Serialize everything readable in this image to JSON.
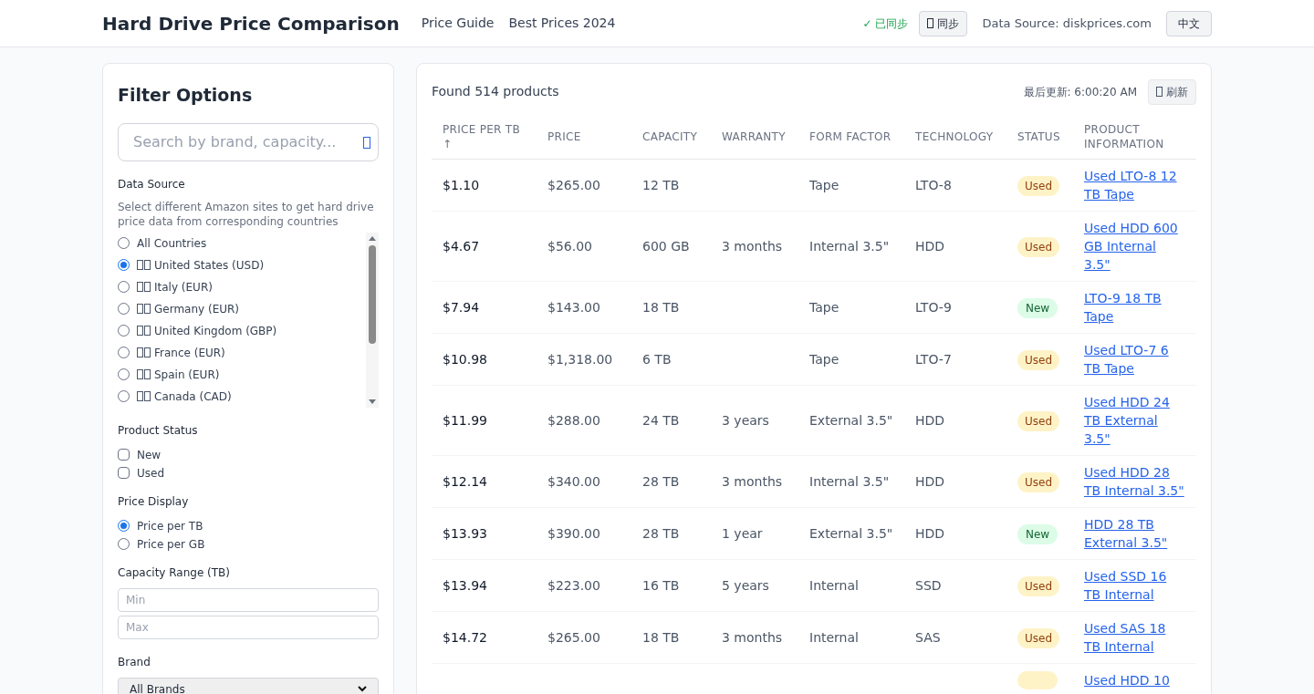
{
  "header": {
    "title": "Hard Drive Price Comparison",
    "nav": [
      "Price Guide",
      "Best Prices 2024"
    ],
    "sync_status": "✓ 已同步",
    "sync_button": "同步",
    "data_source": "Data Source: diskprices.com",
    "language_button": "中文"
  },
  "filters": {
    "title": "Filter Options",
    "search": {
      "placeholder": "Search by brand, capacity..."
    },
    "data_source": {
      "label": "Data Source",
      "hint": "Select different Amazon sites to get hard drive price data from corresponding countries",
      "options": [
        {
          "flag": false,
          "label": "All Countries",
          "selected": false
        },
        {
          "flag": true,
          "label": "United States (USD)",
          "selected": true
        },
        {
          "flag": true,
          "label": "Italy (EUR)",
          "selected": false
        },
        {
          "flag": true,
          "label": "Germany (EUR)",
          "selected": false
        },
        {
          "flag": true,
          "label": "United Kingdom (GBP)",
          "selected": false
        },
        {
          "flag": true,
          "label": "France (EUR)",
          "selected": false
        },
        {
          "flag": true,
          "label": "Spain (EUR)",
          "selected": false
        },
        {
          "flag": true,
          "label": "Canada (CAD)",
          "selected": false
        }
      ]
    },
    "product_status": {
      "label": "Product Status",
      "options": [
        {
          "label": "New",
          "checked": false
        },
        {
          "label": "Used",
          "checked": false
        }
      ]
    },
    "price_display": {
      "label": "Price Display",
      "options": [
        {
          "label": "Price per TB",
          "selected": true
        },
        {
          "label": "Price per GB",
          "selected": false
        }
      ]
    },
    "capacity": {
      "label": "Capacity Range (TB)",
      "min_placeholder": "Min",
      "max_placeholder": "Max"
    },
    "brand": {
      "label": "Brand",
      "value": "All Brands"
    }
  },
  "results": {
    "count": "Found 514 products",
    "last_updated": "最后更新: 6:00:20 AM",
    "refresh_button": "刷新",
    "columns": [
      "PRICE PER TB ↑",
      "PRICE",
      "CAPACITY",
      "WARRANTY",
      "FORM FACTOR",
      "TECHNOLOGY",
      "STATUS",
      "PRODUCT INFORMATION"
    ],
    "rows": [
      {
        "price_per_tb": "$1.10",
        "price": "$265.00",
        "capacity": "12 TB",
        "warranty": "",
        "form_factor": "Tape",
        "technology": "LTO-8",
        "status": {
          "kind": "used",
          "label": "Used"
        },
        "product": "Used LTO-8 12 TB Tape"
      },
      {
        "price_per_tb": "$4.67",
        "price": "$56.00",
        "capacity": "600 GB",
        "warranty": "3 months",
        "form_factor": "Internal 3.5\"",
        "technology": "HDD",
        "status": {
          "kind": "used",
          "label": "Used"
        },
        "product": "Used HDD 600 GB Internal 3.5\""
      },
      {
        "price_per_tb": "$7.94",
        "price": "$143.00",
        "capacity": "18 TB",
        "warranty": "",
        "form_factor": "Tape",
        "technology": "LTO-9",
        "status": {
          "kind": "new",
          "label": "New"
        },
        "product": "LTO-9 18 TB Tape"
      },
      {
        "price_per_tb": "$10.98",
        "price": "$1,318.00",
        "capacity": "6 TB",
        "warranty": "",
        "form_factor": "Tape",
        "technology": "LTO-7",
        "status": {
          "kind": "used",
          "label": "Used"
        },
        "product": "Used LTO-7 6 TB Tape"
      },
      {
        "price_per_tb": "$11.99",
        "price": "$288.00",
        "capacity": "24 TB",
        "warranty": "3 years",
        "form_factor": "External 3.5\"",
        "technology": "HDD",
        "status": {
          "kind": "used",
          "label": "Used"
        },
        "product": "Used HDD 24 TB External 3.5\""
      },
      {
        "price_per_tb": "$12.14",
        "price": "$340.00",
        "capacity": "28 TB",
        "warranty": "3 months",
        "form_factor": "Internal 3.5\"",
        "technology": "HDD",
        "status": {
          "kind": "used",
          "label": "Used"
        },
        "product": "Used HDD 28 TB Internal 3.5\""
      },
      {
        "price_per_tb": "$13.93",
        "price": "$390.00",
        "capacity": "28 TB",
        "warranty": "1 year",
        "form_factor": "External 3.5\"",
        "technology": "HDD",
        "status": {
          "kind": "new",
          "label": "New"
        },
        "product": "HDD 28 TB External 3.5\""
      },
      {
        "price_per_tb": "$13.94",
        "price": "$223.00",
        "capacity": "16 TB",
        "warranty": "5 years",
        "form_factor": "Internal",
        "technology": "SSD",
        "status": {
          "kind": "used",
          "label": "Used"
        },
        "product": "Used SSD 16 TB Internal"
      },
      {
        "price_per_tb": "$14.72",
        "price": "$265.00",
        "capacity": "18 TB",
        "warranty": "3 months",
        "form_factor": "Internal",
        "technology": "SAS",
        "status": {
          "kind": "used",
          "label": "Used"
        },
        "product": "Used SAS 18 TB Internal"
      },
      {
        "status": {
          "kind": "used"
        },
        "product": "Used HDD 10"
      }
    ]
  }
}
